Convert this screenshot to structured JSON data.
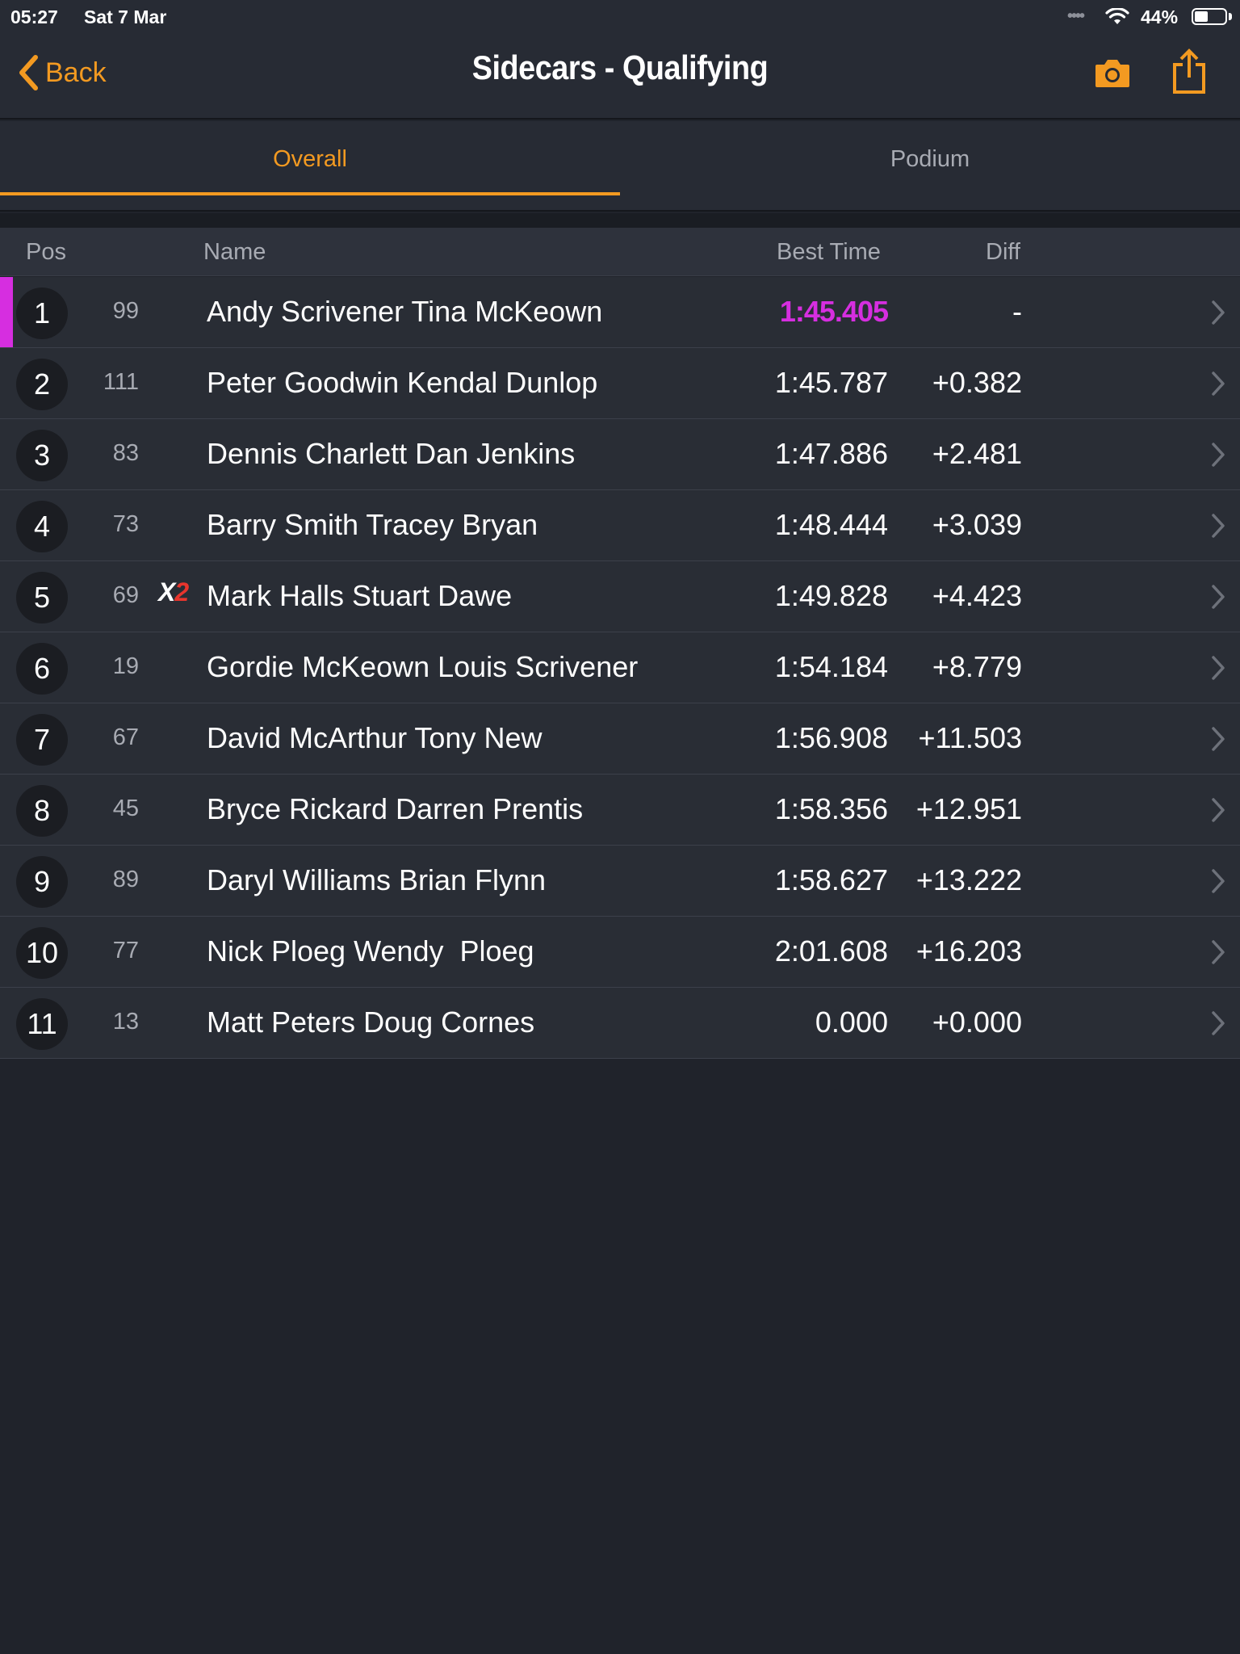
{
  "status_bar": {
    "time": "05:27",
    "date": "Sat 7 Mar",
    "signal_dots": "••••",
    "battery_percent": "44%",
    "battery_level": 0.44
  },
  "nav": {
    "back_label": "Back",
    "title": "Sidecars - Qualifying",
    "icons": [
      "camera-icon",
      "share-icon"
    ]
  },
  "tabs": [
    {
      "label": "Overall",
      "active": true
    },
    {
      "label": "Podium",
      "active": false
    }
  ],
  "table": {
    "headers": {
      "pos": "Pos",
      "name": "Name",
      "best_time": "Best Time",
      "diff": "Diff"
    },
    "rows": [
      {
        "pos": "1",
        "number": "99",
        "name": "Andy Scrivener Tina McKeown",
        "best_time": "1:45.405",
        "diff": "-",
        "fastest": true
      },
      {
        "pos": "2",
        "number": "111",
        "name": "Peter Goodwin Kendal Dunlop",
        "best_time": "1:45.787",
        "diff": "+0.382"
      },
      {
        "pos": "3",
        "number": "83",
        "name": "Dennis Charlett Dan Jenkins",
        "best_time": "1:47.886",
        "diff": "+2.481"
      },
      {
        "pos": "4",
        "number": "73",
        "name": "Barry Smith Tracey Bryan",
        "best_time": "1:48.444",
        "diff": "+3.039"
      },
      {
        "pos": "5",
        "number": "69",
        "badge": {
          "x": "X",
          "two": "2"
        },
        "name": "Mark Halls Stuart Dawe",
        "best_time": "1:49.828",
        "diff": "+4.423"
      },
      {
        "pos": "6",
        "number": "19",
        "name": "Gordie McKeown Louis Scrivener",
        "best_time": "1:54.184",
        "diff": "+8.779"
      },
      {
        "pos": "7",
        "number": "67",
        "name": "David McArthur Tony New",
        "best_time": "1:56.908",
        "diff": "+11.503"
      },
      {
        "pos": "8",
        "number": "45",
        "name": "Bryce Rickard Darren Prentis",
        "best_time": "1:58.356",
        "diff": "+12.951"
      },
      {
        "pos": "9",
        "number": "89",
        "name": "Daryl Williams Brian Flynn",
        "best_time": "1:58.627",
        "diff": "+13.222"
      },
      {
        "pos": "10",
        "number": "77",
        "name": "Nick Ploeg Wendy  Ploeg",
        "best_time": "2:01.608",
        "diff": "+16.203"
      },
      {
        "pos": "11",
        "number": "13",
        "name": "Matt Peters Doug Cornes",
        "best_time": "0.000",
        "diff": "+0.000"
      }
    ]
  },
  "colors": {
    "accent": "#f39a21",
    "fastest": "#d62ee0",
    "background": "#20232b",
    "row": "#292d35",
    "x2_red": "#e8352d"
  }
}
